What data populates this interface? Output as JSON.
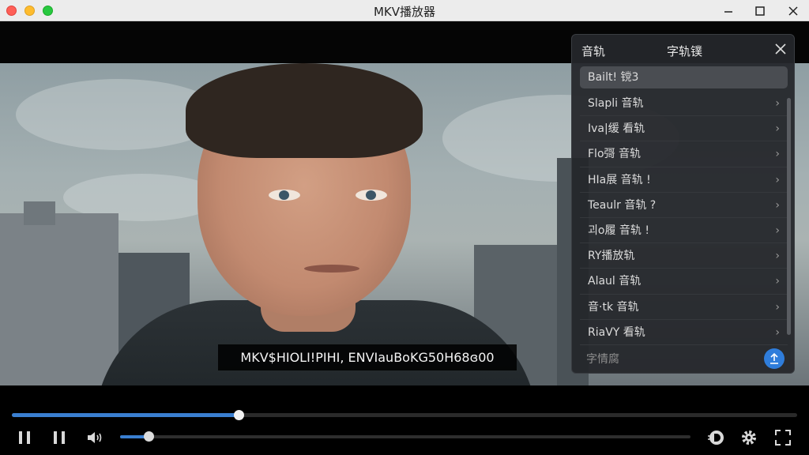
{
  "window": {
    "title": "MKV播放器"
  },
  "video": {
    "subtitle": "MKV$HIOLI!PIHI, ENVIauBoKG50H68ɞ00"
  },
  "panel": {
    "tab_audio": "音轨",
    "tab_subtitles": "字轨镤",
    "tracks": [
      "Bailt! 镋3",
      "Slapli 音轨",
      "Iva|缓 看轨",
      "Flo彁 音轨",
      "HIa展 音轨 !",
      "Teaulr 音轨 ?",
      "괴o履 音轨 !",
      "RY播放轨",
      "Alaul 音轨",
      "音·tk 音轨",
      "RiaVY 看轨"
    ],
    "footer_label": "字情腐"
  },
  "player": {
    "progress": 0.289,
    "volume": 0.05
  },
  "colors": {
    "accent": "#3a7fd0",
    "panel_bg": "#24262a"
  }
}
